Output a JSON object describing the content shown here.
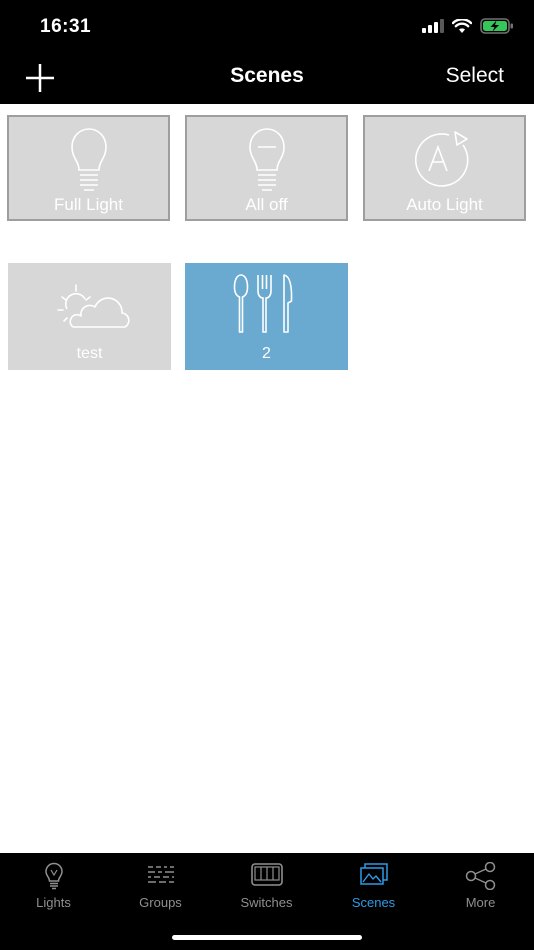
{
  "status_bar": {
    "time": "16:31"
  },
  "nav": {
    "title": "Scenes",
    "select_label": "Select"
  },
  "scenes": [
    {
      "label": "Full Light",
      "icon": "lightbulb-icon"
    },
    {
      "label": "All off",
      "icon": "lightbulb-off-icon"
    },
    {
      "label": "Auto Light",
      "icon": "auto-light-icon"
    },
    {
      "label": "test",
      "icon": "sun-cloud-icon"
    },
    {
      "label": "2",
      "icon": "cutlery-icon",
      "selected": true
    }
  ],
  "tabs": [
    {
      "label": "Lights",
      "icon": "lightbulb-icon"
    },
    {
      "label": "Groups",
      "icon": "groups-icon"
    },
    {
      "label": "Switches",
      "icon": "switches-icon"
    },
    {
      "label": "Scenes",
      "icon": "scenes-icon",
      "active": true
    },
    {
      "label": "More",
      "icon": "share-icon"
    }
  ],
  "colors": {
    "tile": "#d7d7d7",
    "tile_selected": "#6aaad0",
    "tab_active": "#2e9be8",
    "tab_inactive": "#8f8f8f"
  }
}
